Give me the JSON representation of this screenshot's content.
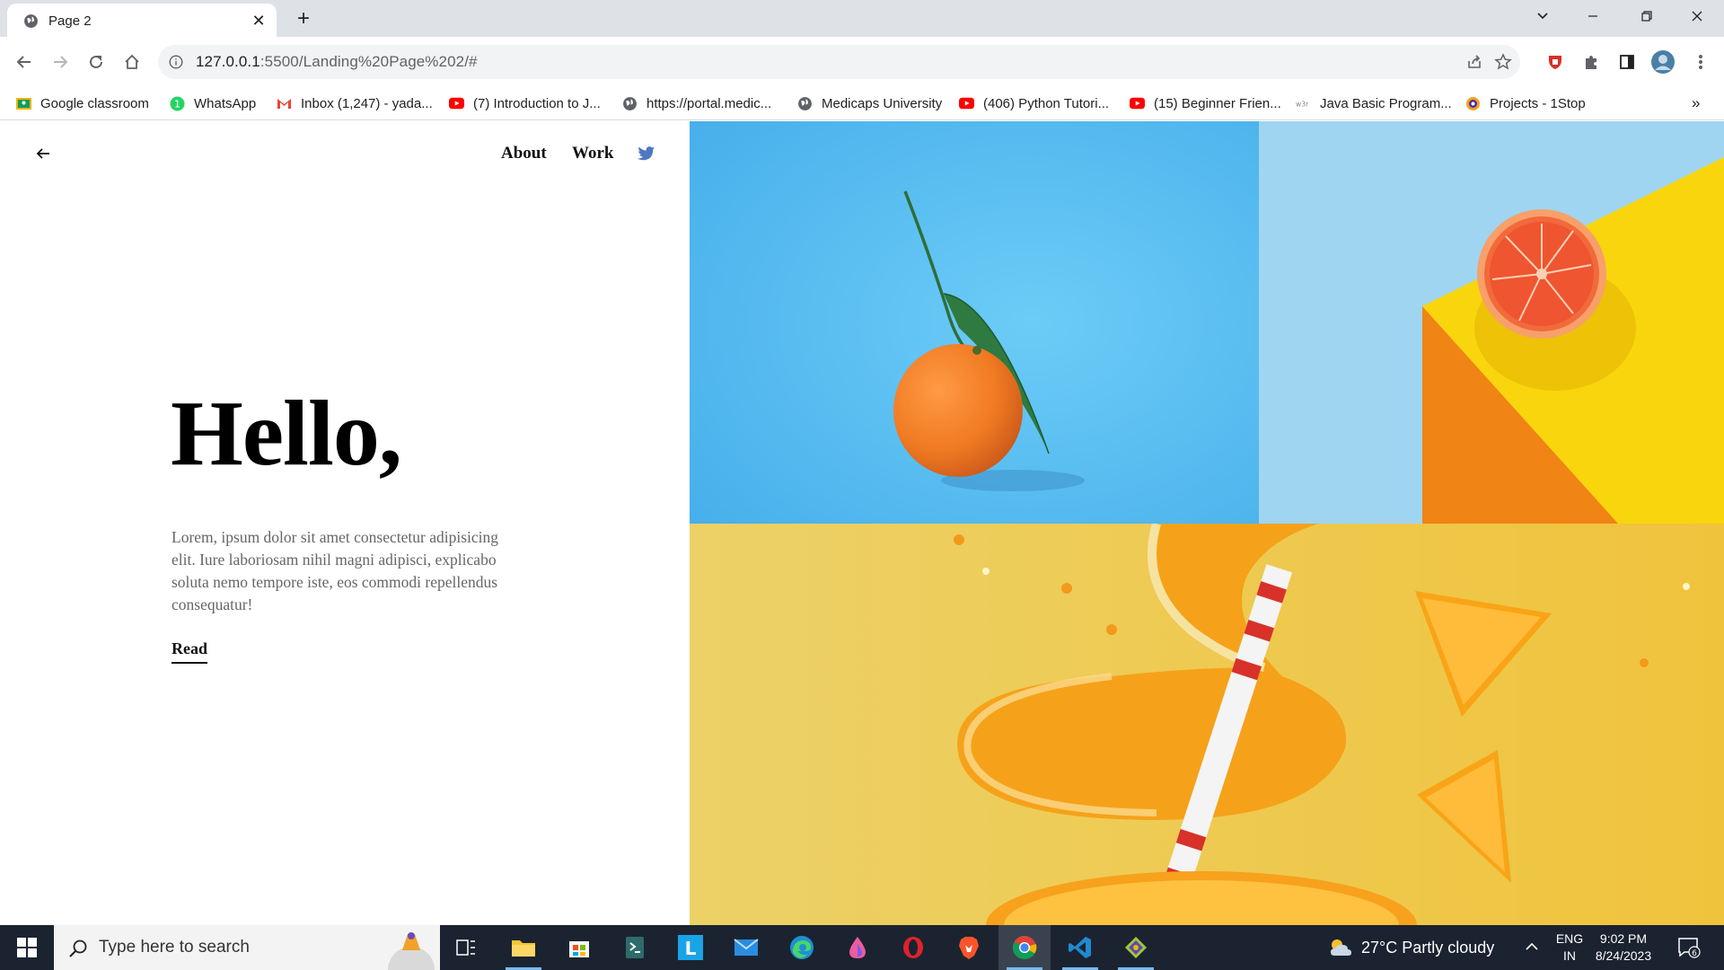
{
  "browser": {
    "tab_title": "Page 2",
    "tab_close": "✕",
    "new_tab": "+",
    "url_host": "127.0.0.1",
    "url_path": ":5500/Landing%20Page%202/#"
  },
  "bookmarks": [
    {
      "label": "Google classroom",
      "icon": "google-classroom-icon"
    },
    {
      "label": "WhatsApp",
      "icon": "whatsapp-icon"
    },
    {
      "label": "Inbox (1,247) - yada...",
      "icon": "gmail-icon"
    },
    {
      "label": "(7) Introduction to J...",
      "icon": "youtube-icon"
    },
    {
      "label": "https://portal.medic...",
      "icon": "globe-icon"
    },
    {
      "label": "Medicaps University",
      "icon": "globe-icon"
    },
    {
      "label": "(406) Python Tutori...",
      "icon": "youtube-icon"
    },
    {
      "label": "(15) Beginner Frien...",
      "icon": "youtube-icon"
    },
    {
      "label": "Java Basic Program...",
      "icon": "w3r-icon"
    },
    {
      "label": "Projects - 1Stop",
      "icon": "onestop-icon"
    }
  ],
  "bookmarks_more": "»",
  "page": {
    "nav_about": "About",
    "nav_work": "Work",
    "hero_title": "Hello,",
    "hero_text": "Lorem, ipsum dolor sit amet consectetur adipisicing elit. Iure laboriosam nihil magni adipisci, explicabo soluta nemo tempore iste, eos commodi repellendus consequatur!",
    "read_link": "Read"
  },
  "taskbar": {
    "search_placeholder": "Type here to search",
    "weather": "27°C  Partly cloudy",
    "lang_line1": "ENG",
    "lang_line2": "IN",
    "time": "9:02 PM",
    "date": "8/24/2023",
    "notification_count": "6"
  },
  "colors": {
    "sky_blue": "#5ab8ee",
    "pale_blue": "#9fd5f0",
    "yellow": "#f7d21a",
    "orange": "#f08a1c",
    "mustard": "#f0cf55"
  }
}
